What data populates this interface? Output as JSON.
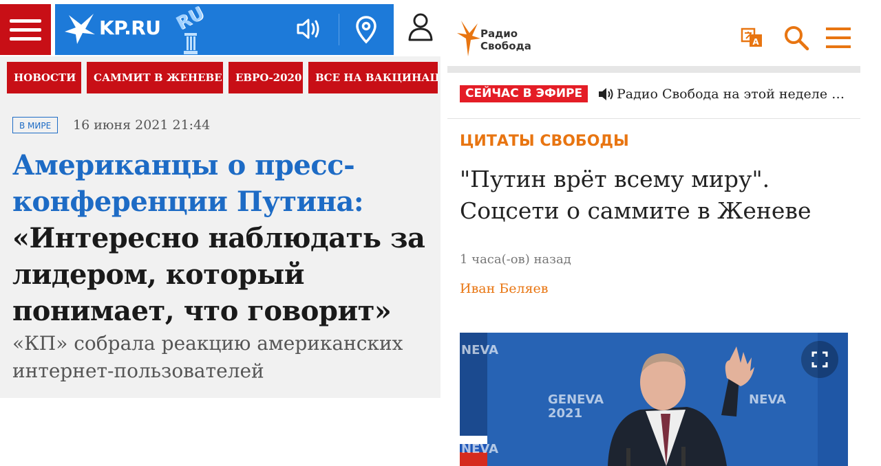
{
  "kp": {
    "logo_text": "KP.RU",
    "badge_text": "RU",
    "nav": [
      "НОВОСТИ",
      "САММИТ В ЖЕНЕВЕ",
      "ЕВРО-2020",
      "ВСЕ НА ВАКЦИНАЦИЮ"
    ],
    "article": {
      "rubric": "В МИРЕ",
      "date": "16 июня 2021 21:44",
      "title_blue": "Американцы о пресс-конференции Путина:",
      "title_black": "«Интересно наблюдать за лидером, который понимает, что говорит»",
      "lead": "«КП» собрала реакцию американских интернет-пользователей"
    },
    "icons": [
      "menu-icon",
      "kp-bird-logo",
      "sound-icon",
      "location-pin-icon",
      "user-icon"
    ],
    "colors": {
      "red": "#c80f16",
      "blue": "#1d7ad9",
      "title_blue": "#1d6bc5"
    }
  },
  "rs": {
    "logo_line1": "Радио",
    "logo_line2": "Свобода",
    "live_badge": "СЕЙЧАС В ЭФИРЕ",
    "live_title": "Радио Свобода на этой неделе …",
    "section": "ЦИТАТЫ СВОБОДЫ",
    "headline": "\"Путин врёт всему миру\". Соцсети о саммите в Женеве",
    "time": "1 часа(-ов) назад",
    "author": "Иван Беляев",
    "photo_text": {
      "geneva": "GENEVA",
      "year": "2021",
      "partial": "NEVA"
    },
    "icons": [
      "radio-svoboda-logo",
      "translate-icon",
      "search-icon",
      "menu-icon",
      "speaker-icon",
      "expand-icon"
    ],
    "colors": {
      "orange": "#e87511",
      "live_red": "#e41d26"
    }
  }
}
